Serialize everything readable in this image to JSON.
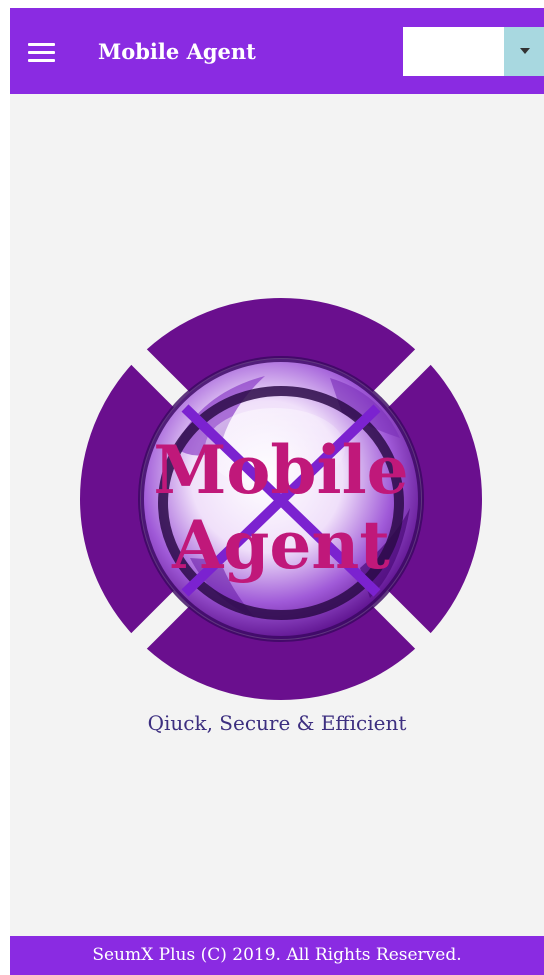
{
  "header": {
    "menu_icon": "hamburger-menu-icon",
    "title": "Mobile Agent",
    "select": {
      "value": "",
      "arrow_icon": "caret-down-icon"
    }
  },
  "logo": {
    "line1": "Mobile",
    "line2": "Agent"
  },
  "tagline": "Qiuck, Secure & Efficient",
  "footer": {
    "text": "SeumX Plus (C) 2019. All Rights Reserved."
  },
  "colors": {
    "primary": "#8a2be2",
    "logo_ring": "#6a0f8e",
    "logo_text": "#c0187a",
    "tagline": "#3d2f80",
    "background": "#f3f3f3",
    "select_arrow_bg": "#a8d8e0"
  }
}
